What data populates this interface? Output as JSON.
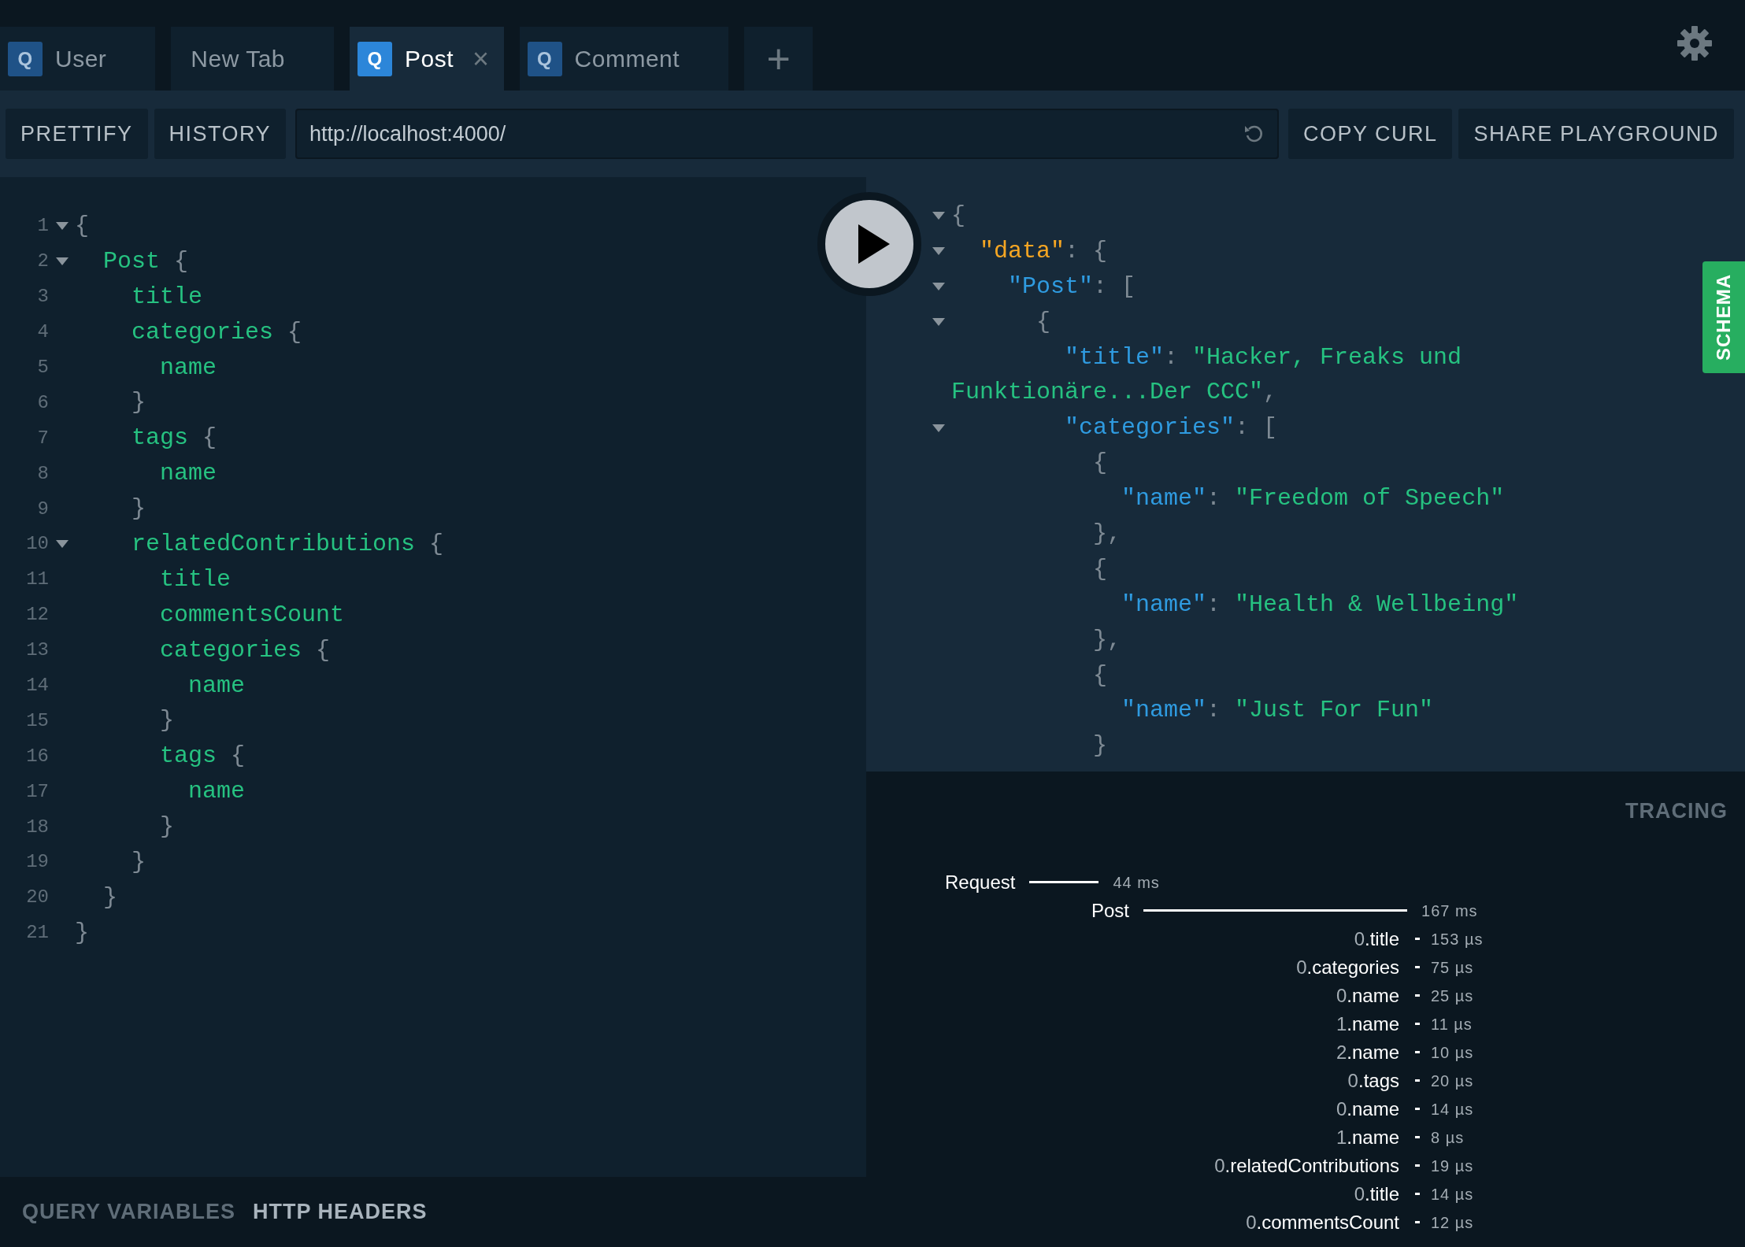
{
  "tabs": [
    {
      "icon": "Q",
      "label": "User",
      "selected": false
    },
    {
      "label": "New Tab",
      "selected": false
    },
    {
      "icon": "Q",
      "label": "Post",
      "selected": true,
      "close": "×"
    },
    {
      "icon": "Q",
      "label": "Comment",
      "selected": false
    }
  ],
  "new_tab": "+",
  "toolbar": {
    "buttons": [
      "PRETTIFY",
      "HISTORY"
    ],
    "url": "http://localhost:4000/",
    "right_buttons": [
      "COPY CURL",
      "SHARE PLAYGROUND"
    ]
  },
  "editor": {
    "lines": [
      {
        "number": "1",
        "fold": true,
        "text": "{"
      },
      {
        "number": "2",
        "fold": true,
        "text": "  Post {"
      },
      {
        "number": "3",
        "fold": false,
        "text": "    title"
      },
      {
        "number": "4",
        "fold": false,
        "text": "    categories {"
      },
      {
        "number": "5",
        "fold": false,
        "text": "      name"
      },
      {
        "number": "6",
        "fold": false,
        "text": "    }"
      },
      {
        "number": "7",
        "fold": false,
        "text": "    tags {"
      },
      {
        "number": "8",
        "fold": false,
        "text": "      name"
      },
      {
        "number": "9",
        "fold": false,
        "text": "    }"
      },
      {
        "number": "10",
        "fold": true,
        "text": "    relatedContributions {"
      },
      {
        "number": "11",
        "fold": false,
        "text": "      title"
      },
      {
        "number": "12",
        "fold": false,
        "text": "      commentsCount"
      },
      {
        "number": "13",
        "fold": false,
        "text": "      categories {"
      },
      {
        "number": "14",
        "fold": false,
        "text": "        name"
      },
      {
        "number": "15",
        "fold": false,
        "text": "      }"
      },
      {
        "number": "16",
        "fold": false,
        "text": "      tags {"
      },
      {
        "number": "17",
        "fold": false,
        "text": "        name"
      },
      {
        "number": "18",
        "fold": false,
        "text": "      }"
      },
      {
        "number": "19",
        "fold": false,
        "text": "    }"
      },
      {
        "number": "20",
        "fold": false,
        "text": "  }"
      },
      {
        "number": "21",
        "fold": false,
        "text": "}"
      }
    ]
  },
  "bottom_tabs": [
    {
      "label": "QUERY VARIABLES",
      "selected": false
    },
    {
      "label": "HTTP HEADERS",
      "selected": true
    }
  ],
  "result": {
    "lines": [
      {
        "fold": true,
        "segments": [
          {
            "kind": "punct",
            "text": "{"
          }
        ]
      },
      {
        "fold": true,
        "segments": [
          {
            "kind": "root",
            "text": "  \"data\""
          },
          {
            "kind": "punct",
            "text": ": {"
          }
        ]
      },
      {
        "fold": true,
        "segments": [
          {
            "kind": "key",
            "text": "    \"Post\""
          },
          {
            "kind": "punct",
            "text": ": ["
          }
        ]
      },
      {
        "fold": true,
        "segments": [
          {
            "kind": "punct",
            "text": "      {"
          }
        ]
      },
      {
        "fold": false,
        "segments": [
          {
            "kind": "key",
            "text": "        \"title\""
          },
          {
            "kind": "punct",
            "text": ": "
          },
          {
            "kind": "string",
            "text": "\"Hacker, Freaks und"
          }
        ]
      },
      {
        "fold": false,
        "segments": [
          {
            "kind": "string",
            "text": "Funktionäre...Der CCC\""
          },
          {
            "kind": "punct",
            "text": ","
          }
        ]
      },
      {
        "fold": true,
        "segments": [
          {
            "kind": "key",
            "text": "        \"categories\""
          },
          {
            "kind": "punct",
            "text": ": ["
          }
        ]
      },
      {
        "fold": false,
        "segments": [
          {
            "kind": "punct",
            "text": "          {"
          }
        ]
      },
      {
        "fold": false,
        "segments": [
          {
            "kind": "key",
            "text": "            \"name\""
          },
          {
            "kind": "punct",
            "text": ": "
          },
          {
            "kind": "string",
            "text": "\"Freedom of Speech\""
          }
        ]
      },
      {
        "fold": false,
        "segments": [
          {
            "kind": "punct",
            "text": "          },"
          }
        ]
      },
      {
        "fold": false,
        "segments": [
          {
            "kind": "punct",
            "text": "          {"
          }
        ]
      },
      {
        "fold": false,
        "segments": [
          {
            "kind": "key",
            "text": "            \"name\""
          },
          {
            "kind": "punct",
            "text": ": "
          },
          {
            "kind": "string",
            "text": "\"Health & Wellbeing\""
          }
        ]
      },
      {
        "fold": false,
        "segments": [
          {
            "kind": "punct",
            "text": "          },"
          }
        ]
      },
      {
        "fold": false,
        "segments": [
          {
            "kind": "punct",
            "text": "          {"
          }
        ]
      },
      {
        "fold": false,
        "segments": [
          {
            "kind": "key",
            "text": "            \"name\""
          },
          {
            "kind": "punct",
            "text": ": "
          },
          {
            "kind": "string",
            "text": "\"Just For Fun\""
          }
        ]
      },
      {
        "fold": false,
        "segments": [
          {
            "kind": "punct",
            "text": "          }"
          }
        ]
      }
    ]
  },
  "schema_tab": "SCHEMA",
  "tracing": {
    "title": "TRACING",
    "rows": [
      {
        "kind": "request",
        "label": "Request",
        "duration": "44 ms"
      },
      {
        "kind": "resolver",
        "label": "Post",
        "duration": "167 ms"
      },
      {
        "kind": "field",
        "label": "0.title",
        "duration": "153 µs"
      },
      {
        "kind": "field",
        "label": "0.categories",
        "duration": "75 µs"
      },
      {
        "kind": "field",
        "label": "0.name",
        "duration": "25 µs"
      },
      {
        "kind": "field",
        "label": "1.name",
        "duration": "11 µs"
      },
      {
        "kind": "field",
        "label": "2.name",
        "duration": "10 µs"
      },
      {
        "kind": "field",
        "label": "0.tags",
        "duration": "20 µs"
      },
      {
        "kind": "field",
        "label": "0.name",
        "duration": "14 µs"
      },
      {
        "kind": "field",
        "label": "1.name",
        "duration": "8 µs"
      },
      {
        "kind": "field",
        "label": "0.relatedContributions",
        "duration": "19 µs"
      },
      {
        "kind": "field",
        "label": "0.title",
        "duration": "14 µs"
      },
      {
        "kind": "field",
        "label": "0.commentsCount",
        "duration": "12 µs"
      }
    ]
  }
}
